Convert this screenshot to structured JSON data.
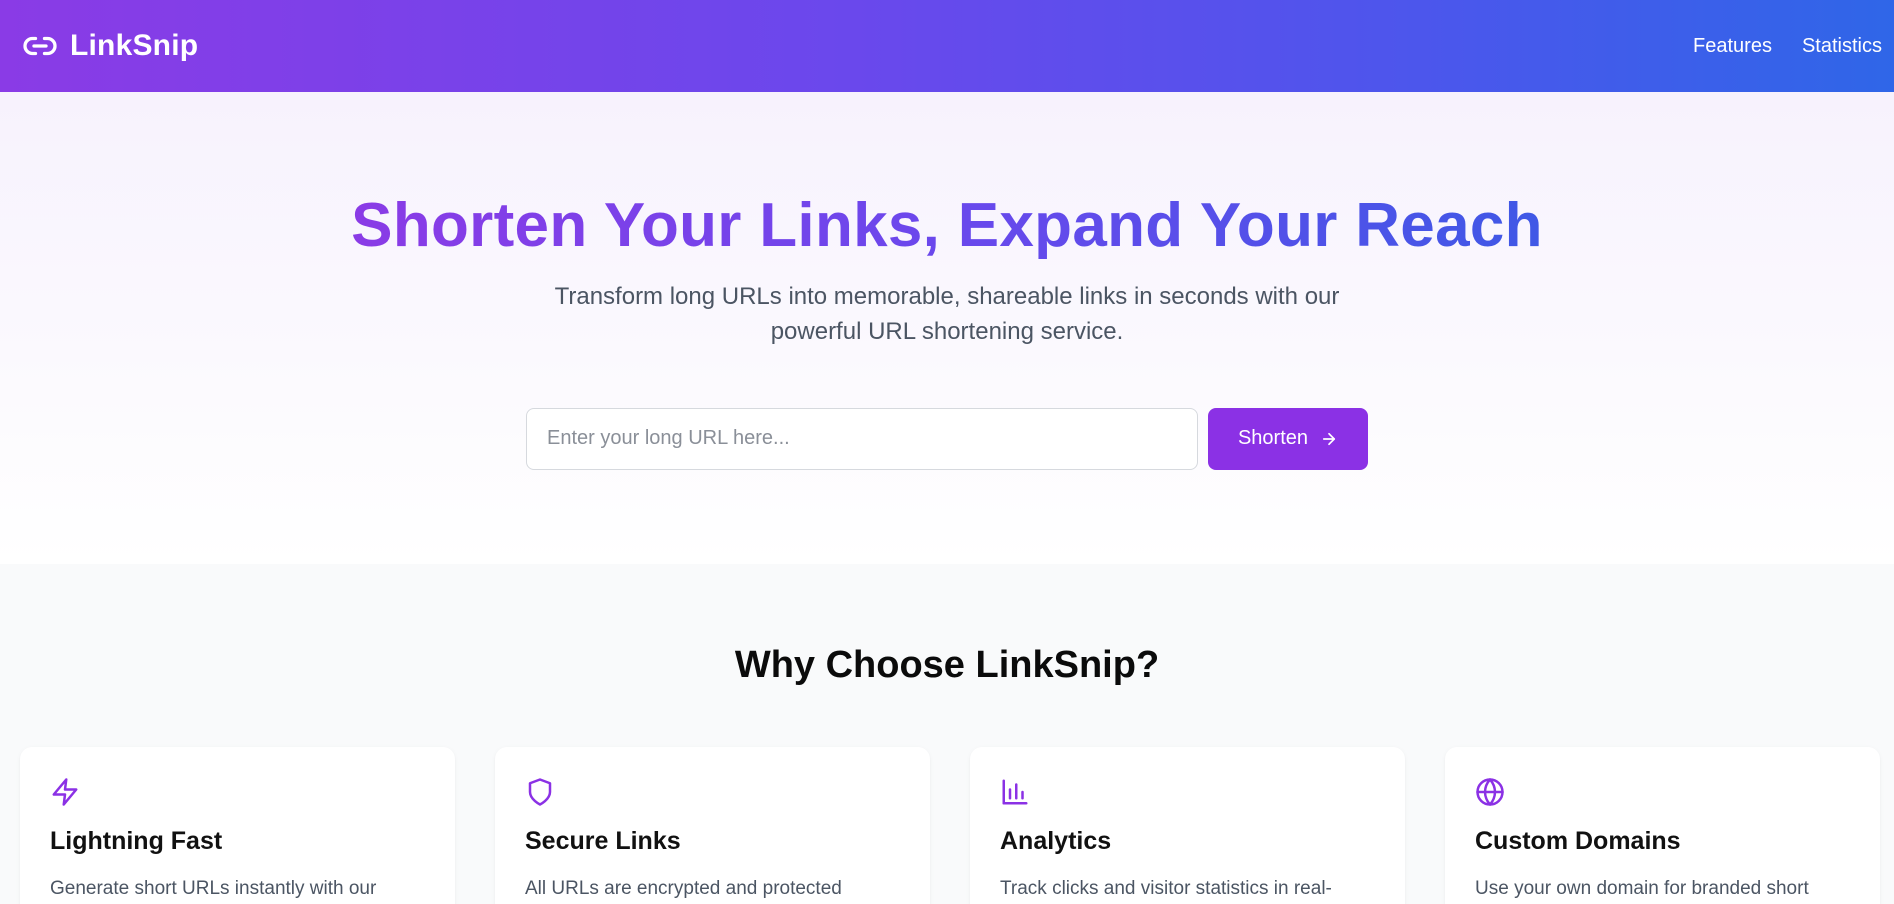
{
  "header": {
    "brand": "LinkSnip",
    "nav": [
      {
        "label": "Features"
      },
      {
        "label": "Statistics"
      }
    ]
  },
  "hero": {
    "title": "Shorten Your Links, Expand Your Reach",
    "subtitle": "Transform long URLs into memorable, shareable links in seconds with our powerful URL shortening service.",
    "input": {
      "value": "",
      "placeholder": "Enter your long URL here..."
    },
    "button_label": "Shorten"
  },
  "features": {
    "title": "Why Choose LinkSnip?",
    "cards": [
      {
        "icon": "lightning-icon",
        "title": "Lightning Fast",
        "description": "Generate short URLs instantly with our"
      },
      {
        "icon": "shield-icon",
        "title": "Secure Links",
        "description": "All URLs are encrypted and protected"
      },
      {
        "icon": "bar-chart-icon",
        "title": "Analytics",
        "description": "Track clicks and visitor statistics in real-"
      },
      {
        "icon": "globe-icon",
        "title": "Custom Domains",
        "description": "Use your own domain for branded short"
      }
    ]
  },
  "colors": {
    "accent": "#8b31e5",
    "header_gradient_start": "#8a3be6",
    "header_gradient_end": "#2f66e8"
  }
}
